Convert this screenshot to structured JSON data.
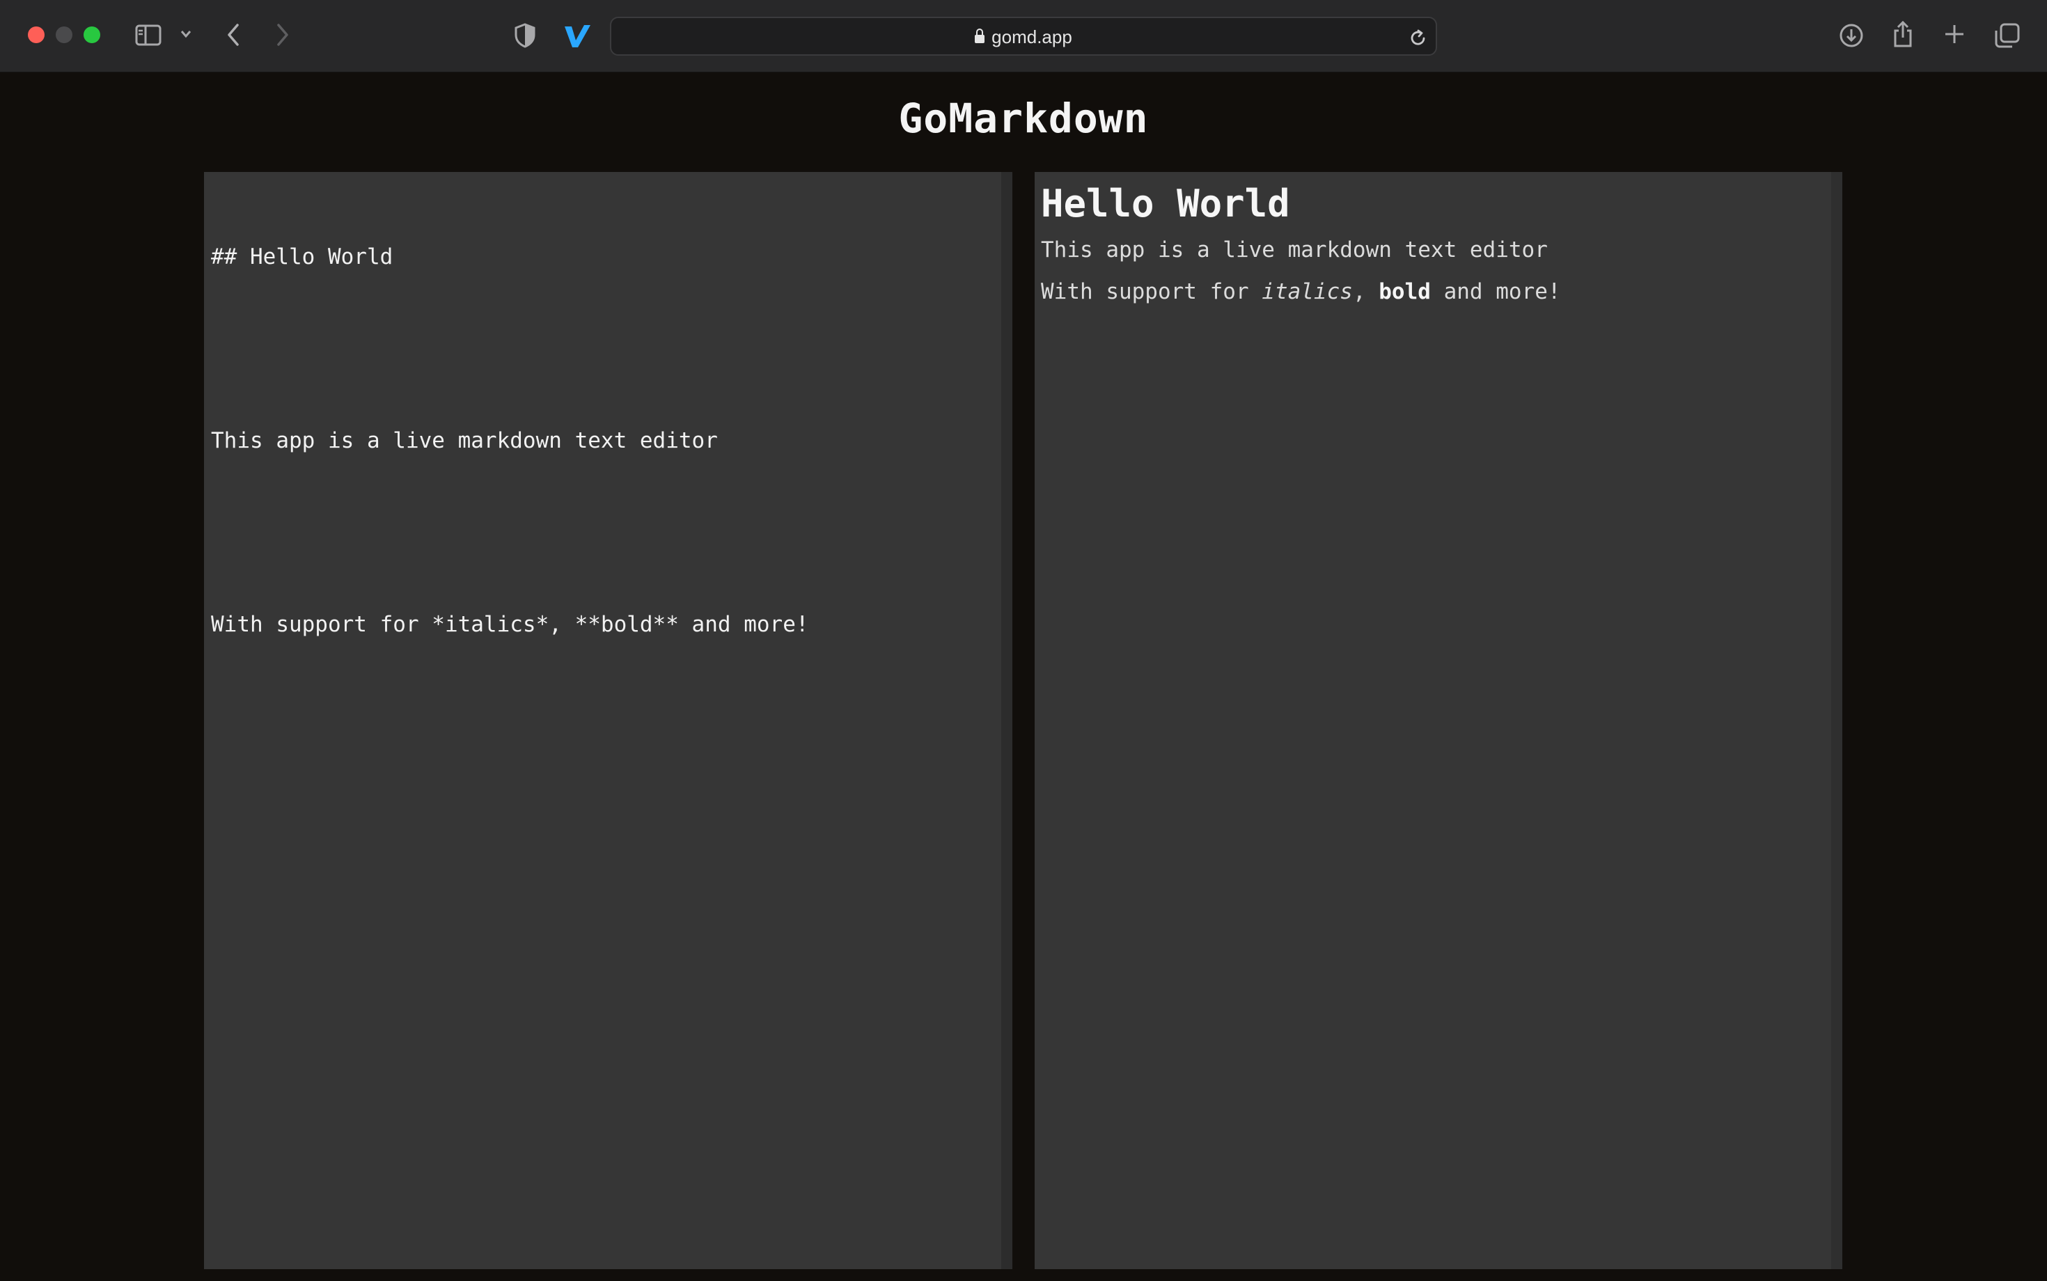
{
  "browser": {
    "url": "gomd.app",
    "icons": [
      "sidebar-icon",
      "chevron-down-icon",
      "back-icon",
      "forward-icon",
      "shield-icon",
      "vercel-v-icon",
      "lock-icon",
      "reload-icon",
      "download-icon",
      "share-icon",
      "plus-icon",
      "tabs-icon"
    ]
  },
  "app": {
    "title": "GoMarkdown"
  },
  "editor": {
    "lines": [
      "## Hello World",
      "",
      "This app is a live markdown text editor",
      "",
      "With support for *italics*, **bold** and more!"
    ]
  },
  "preview": {
    "heading": "Hello World",
    "paragraph1": "This app is a live markdown text editor",
    "p2_prefix": "With support for ",
    "p2_italic": "italics",
    "p2_mid": ", ",
    "p2_bold": "bold",
    "p2_suffix": " and more!"
  },
  "colors": {
    "page_bg": "#110e0b",
    "pane_bg": "#363636",
    "chrome_bg": "#282829",
    "accent_blue": "#2aa7ff"
  }
}
